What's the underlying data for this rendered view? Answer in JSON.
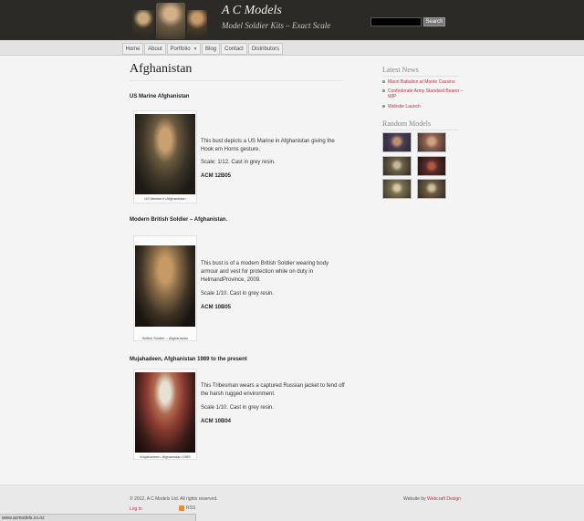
{
  "header": {
    "site_title": "A C Models",
    "tagline": "Model Soldier Kits – Exact Scale",
    "search_button": "Search"
  },
  "nav": [
    "Home",
    "About",
    "Portfolio",
    "Blog",
    "Contact",
    "Distributors"
  ],
  "main": {
    "page_title": "Afghanistan",
    "sections": [
      {
        "heading": "US Marine Afghanistan",
        "caption": "US Marine in Afghanistan",
        "description": "This bust depicts a US Marine in Afghanistan giving the Hook em Horns gesture.",
        "scale": "Scale: 1/12. Cast in grey resin.",
        "code": "ACM 12B05"
      },
      {
        "heading": "Modern British Soldier – Afghanistan.",
        "caption": "British Soldier – Afghanistan",
        "description": "This bust is of a modern British Soldier wearing body armour and vest for protection while on duty in HelmandProvince, 2009.",
        "scale": "Scale 1/10. Cast in grey resin.",
        "code": "ACM 10B05"
      },
      {
        "heading": "Mujahadeen, Afghanistan 1989 to the present",
        "caption": "Mujahadeen, Afghanistan 1989",
        "description": "This Tribesman wears a captured Russian jacket to fend off the harsh rugged environment.",
        "scale": "Scale 1/10. Cast in grey resin.",
        "code": "ACM 10B04"
      }
    ]
  },
  "sidebar": {
    "news_heading": "Latest News",
    "news": [
      "Maori Battalion at Monte Cassino",
      "Confederate Army Standard Bearer – WIP",
      "Website Launch"
    ],
    "random_heading": "Random Models"
  },
  "footer": {
    "copyright": "© 2012, A C Models Ltd. All rights reserved.",
    "login": "Log in",
    "rss": "RSS",
    "credit_prefix": "Website by",
    "credit_link": "Webcraft Design"
  },
  "status_bar": "www.acmodels.co.nz",
  "colors": {
    "header_bg": "#2b2a26",
    "link": "#bb3344"
  }
}
